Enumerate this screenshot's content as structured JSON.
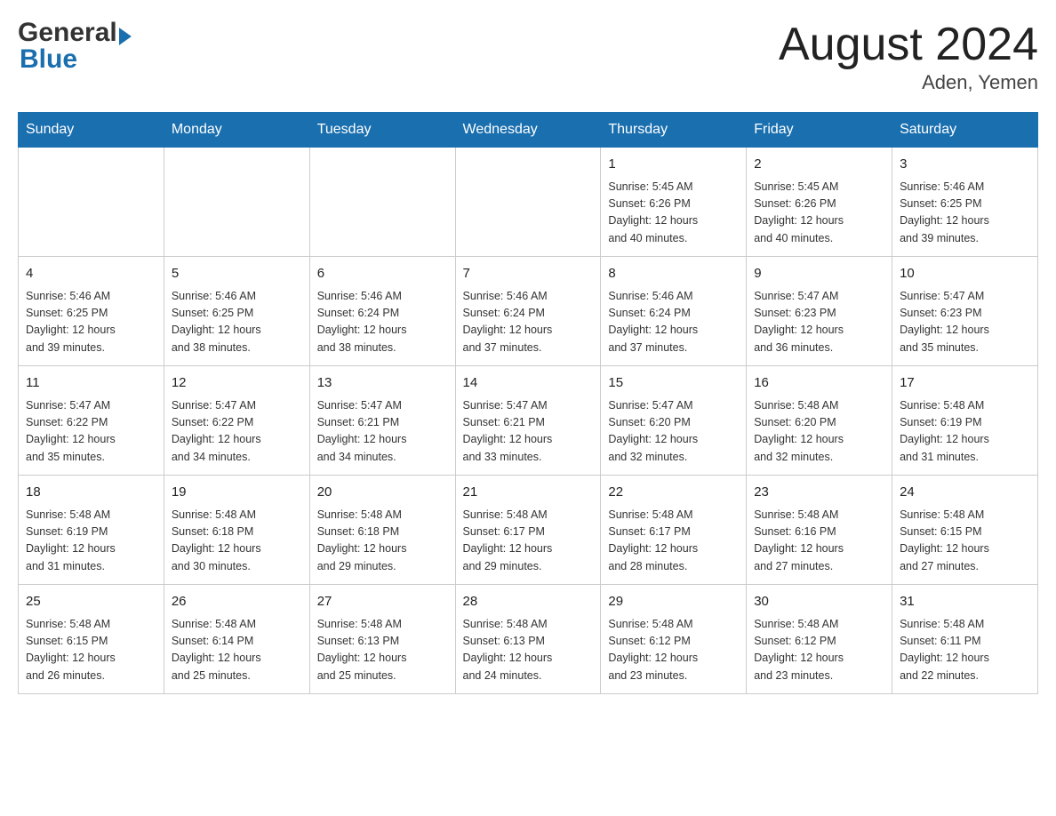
{
  "header": {
    "month_title": "August 2024",
    "location": "Aden, Yemen"
  },
  "logo": {
    "general": "General",
    "blue": "Blue"
  },
  "days_of_week": [
    "Sunday",
    "Monday",
    "Tuesday",
    "Wednesday",
    "Thursday",
    "Friday",
    "Saturday"
  ],
  "weeks": [
    [
      {
        "day": "",
        "info": ""
      },
      {
        "day": "",
        "info": ""
      },
      {
        "day": "",
        "info": ""
      },
      {
        "day": "",
        "info": ""
      },
      {
        "day": "1",
        "info": "Sunrise: 5:45 AM\nSunset: 6:26 PM\nDaylight: 12 hours\nand 40 minutes."
      },
      {
        "day": "2",
        "info": "Sunrise: 5:45 AM\nSunset: 6:26 PM\nDaylight: 12 hours\nand 40 minutes."
      },
      {
        "day": "3",
        "info": "Sunrise: 5:46 AM\nSunset: 6:25 PM\nDaylight: 12 hours\nand 39 minutes."
      }
    ],
    [
      {
        "day": "4",
        "info": "Sunrise: 5:46 AM\nSunset: 6:25 PM\nDaylight: 12 hours\nand 39 minutes."
      },
      {
        "day": "5",
        "info": "Sunrise: 5:46 AM\nSunset: 6:25 PM\nDaylight: 12 hours\nand 38 minutes."
      },
      {
        "day": "6",
        "info": "Sunrise: 5:46 AM\nSunset: 6:24 PM\nDaylight: 12 hours\nand 38 minutes."
      },
      {
        "day": "7",
        "info": "Sunrise: 5:46 AM\nSunset: 6:24 PM\nDaylight: 12 hours\nand 37 minutes."
      },
      {
        "day": "8",
        "info": "Sunrise: 5:46 AM\nSunset: 6:24 PM\nDaylight: 12 hours\nand 37 minutes."
      },
      {
        "day": "9",
        "info": "Sunrise: 5:47 AM\nSunset: 6:23 PM\nDaylight: 12 hours\nand 36 minutes."
      },
      {
        "day": "10",
        "info": "Sunrise: 5:47 AM\nSunset: 6:23 PM\nDaylight: 12 hours\nand 35 minutes."
      }
    ],
    [
      {
        "day": "11",
        "info": "Sunrise: 5:47 AM\nSunset: 6:22 PM\nDaylight: 12 hours\nand 35 minutes."
      },
      {
        "day": "12",
        "info": "Sunrise: 5:47 AM\nSunset: 6:22 PM\nDaylight: 12 hours\nand 34 minutes."
      },
      {
        "day": "13",
        "info": "Sunrise: 5:47 AM\nSunset: 6:21 PM\nDaylight: 12 hours\nand 34 minutes."
      },
      {
        "day": "14",
        "info": "Sunrise: 5:47 AM\nSunset: 6:21 PM\nDaylight: 12 hours\nand 33 minutes."
      },
      {
        "day": "15",
        "info": "Sunrise: 5:47 AM\nSunset: 6:20 PM\nDaylight: 12 hours\nand 32 minutes."
      },
      {
        "day": "16",
        "info": "Sunrise: 5:48 AM\nSunset: 6:20 PM\nDaylight: 12 hours\nand 32 minutes."
      },
      {
        "day": "17",
        "info": "Sunrise: 5:48 AM\nSunset: 6:19 PM\nDaylight: 12 hours\nand 31 minutes."
      }
    ],
    [
      {
        "day": "18",
        "info": "Sunrise: 5:48 AM\nSunset: 6:19 PM\nDaylight: 12 hours\nand 31 minutes."
      },
      {
        "day": "19",
        "info": "Sunrise: 5:48 AM\nSunset: 6:18 PM\nDaylight: 12 hours\nand 30 minutes."
      },
      {
        "day": "20",
        "info": "Sunrise: 5:48 AM\nSunset: 6:18 PM\nDaylight: 12 hours\nand 29 minutes."
      },
      {
        "day": "21",
        "info": "Sunrise: 5:48 AM\nSunset: 6:17 PM\nDaylight: 12 hours\nand 29 minutes."
      },
      {
        "day": "22",
        "info": "Sunrise: 5:48 AM\nSunset: 6:17 PM\nDaylight: 12 hours\nand 28 minutes."
      },
      {
        "day": "23",
        "info": "Sunrise: 5:48 AM\nSunset: 6:16 PM\nDaylight: 12 hours\nand 27 minutes."
      },
      {
        "day": "24",
        "info": "Sunrise: 5:48 AM\nSunset: 6:15 PM\nDaylight: 12 hours\nand 27 minutes."
      }
    ],
    [
      {
        "day": "25",
        "info": "Sunrise: 5:48 AM\nSunset: 6:15 PM\nDaylight: 12 hours\nand 26 minutes."
      },
      {
        "day": "26",
        "info": "Sunrise: 5:48 AM\nSunset: 6:14 PM\nDaylight: 12 hours\nand 25 minutes."
      },
      {
        "day": "27",
        "info": "Sunrise: 5:48 AM\nSunset: 6:13 PM\nDaylight: 12 hours\nand 25 minutes."
      },
      {
        "day": "28",
        "info": "Sunrise: 5:48 AM\nSunset: 6:13 PM\nDaylight: 12 hours\nand 24 minutes."
      },
      {
        "day": "29",
        "info": "Sunrise: 5:48 AM\nSunset: 6:12 PM\nDaylight: 12 hours\nand 23 minutes."
      },
      {
        "day": "30",
        "info": "Sunrise: 5:48 AM\nSunset: 6:12 PM\nDaylight: 12 hours\nand 23 minutes."
      },
      {
        "day": "31",
        "info": "Sunrise: 5:48 AM\nSunset: 6:11 PM\nDaylight: 12 hours\nand 22 minutes."
      }
    ]
  ]
}
